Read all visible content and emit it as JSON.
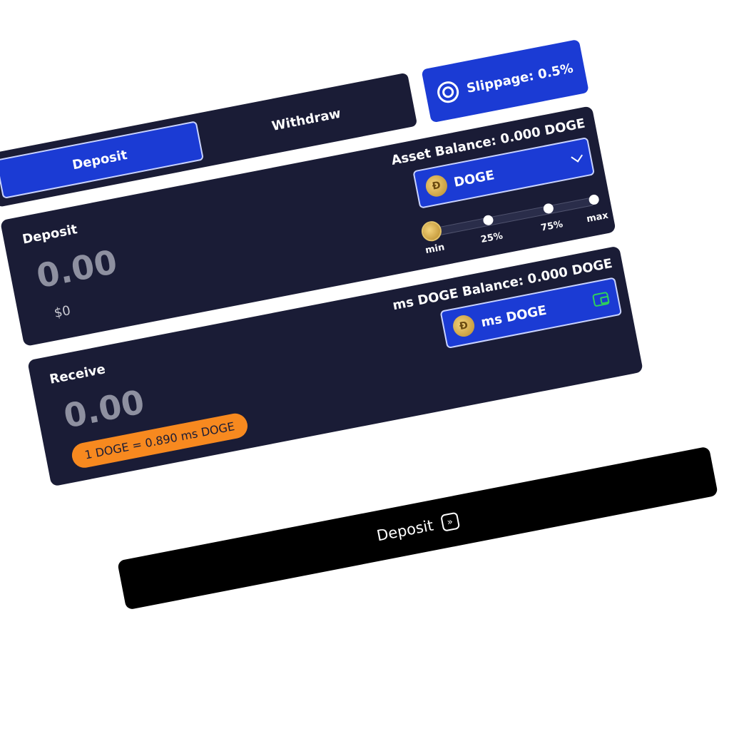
{
  "tabs": {
    "deposit": "Deposit",
    "withdraw": "Withdraw"
  },
  "slippage": {
    "label": "Slippage: 0.5%"
  },
  "deposit_card": {
    "label": "Deposit",
    "amount": "0.00",
    "usd": "$0",
    "balance": "Asset Balance: 0.000 DOGE",
    "asset": "DOGE",
    "slider": {
      "level": 0,
      "marks": [
        "min",
        "25%",
        "75%",
        "max"
      ]
    }
  },
  "receive_card": {
    "label": "Receive",
    "amount": "0.00",
    "balance": "ms DOGE Balance: 0.000 DOGE",
    "asset": "ms DOGE",
    "rate": "1 DOGE = 0.890 ms DOGE"
  },
  "cta": {
    "label": "Deposit"
  },
  "colors": {
    "card": "#1a1c36",
    "accent": "#1b3bd4",
    "badge": "#f7891f",
    "wallet": "#2fd25a"
  }
}
